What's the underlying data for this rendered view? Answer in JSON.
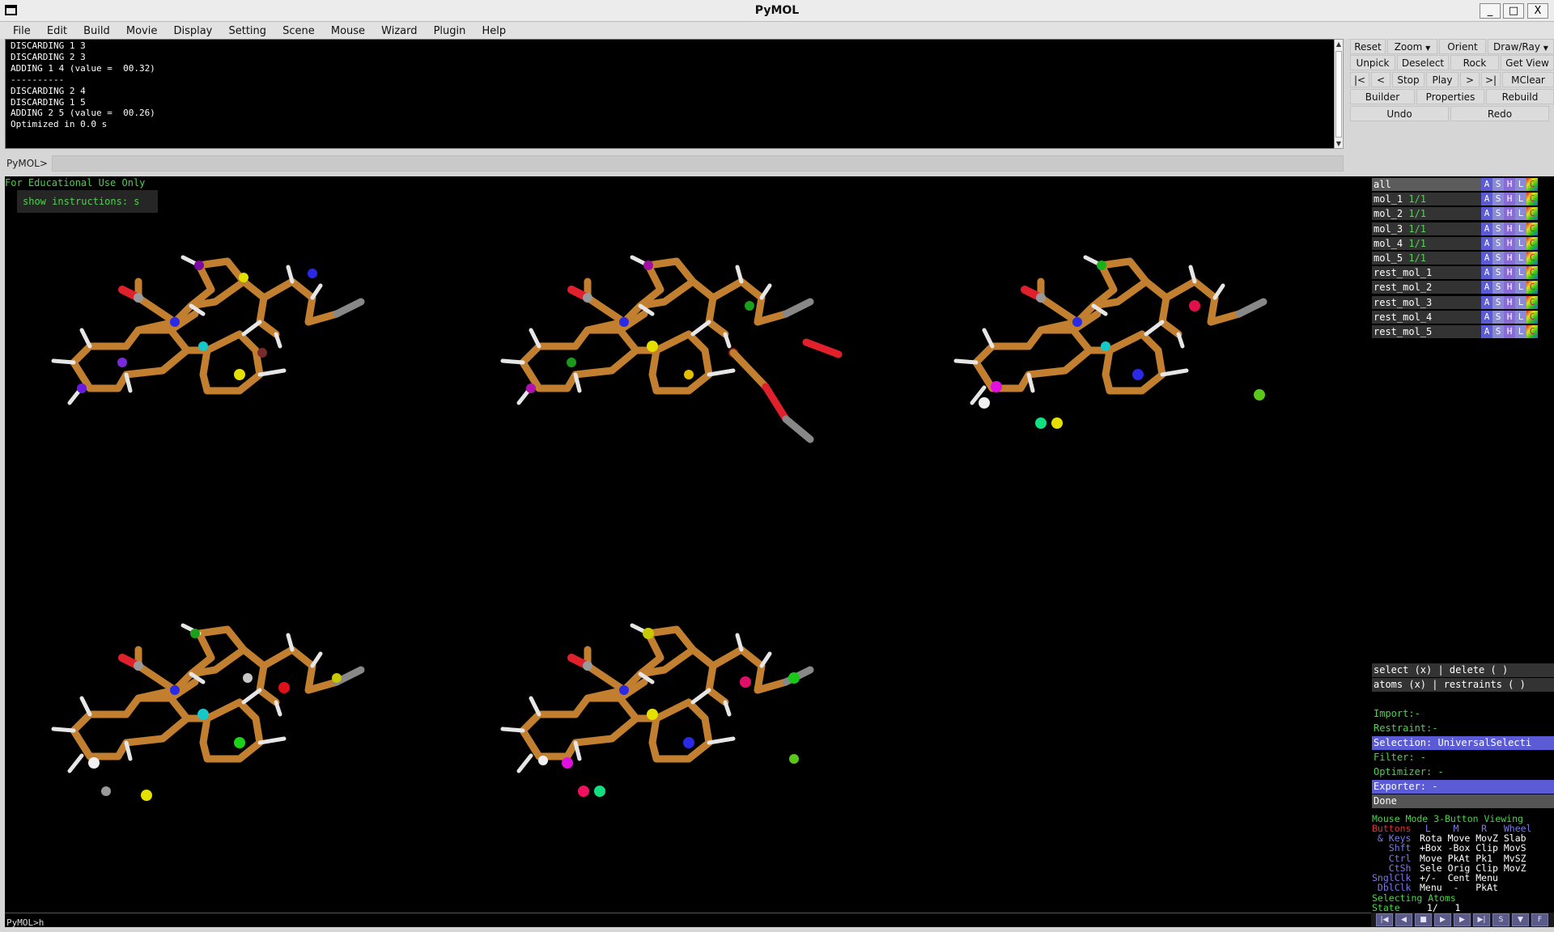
{
  "window": {
    "title": "PyMOL",
    "minimize": "_",
    "maximize": "□",
    "close": "X"
  },
  "menu": [
    "File",
    "Edit",
    "Build",
    "Movie",
    "Display",
    "Setting",
    "Scene",
    "Mouse",
    "Wizard",
    "Plugin",
    "Help"
  ],
  "console": {
    "lines": [
      "DISCARDING 1 3",
      "DISCARDING 2 3",
      "ADDING 1 4 (value =  00.32)",
      "----------",
      "DISCARDING 2 4",
      "DISCARDING 1 5",
      "ADDING 2 5 (value =  00.26)",
      "Optimized in 0.0 s"
    ]
  },
  "command": {
    "prompt": "PyMOL>",
    "bottom_prompt": "PyMOL>h_"
  },
  "buttons": {
    "row1": [
      "Reset",
      "Zoom",
      "Orient",
      "Draw/Ray"
    ],
    "row2": [
      "Unpick",
      "Deselect",
      "Rock",
      "Get View"
    ],
    "row3": [
      "|<",
      "<",
      "Stop",
      "Play",
      ">",
      ">|",
      "MClear"
    ],
    "row4": [
      "Builder",
      "Properties",
      "Rebuild"
    ],
    "row5": [
      "Undo",
      "Redo"
    ]
  },
  "viewer": {
    "edu_text": "For Educational Use Only",
    "instructions": "show instructions: s"
  },
  "objects": [
    {
      "name": "all",
      "state": ""
    },
    {
      "name": "mol_1",
      "state": "1/1"
    },
    {
      "name": "mol_2",
      "state": "1/1"
    },
    {
      "name": "mol_3",
      "state": "1/1"
    },
    {
      "name": "mol_4",
      "state": "1/1"
    },
    {
      "name": "mol_5",
      "state": "1/1"
    },
    {
      "name": "rest_mol_1",
      "state": ""
    },
    {
      "name": "rest_mol_2",
      "state": ""
    },
    {
      "name": "rest_mol_3",
      "state": ""
    },
    {
      "name": "rest_mol_4",
      "state": ""
    },
    {
      "name": "rest_mol_5",
      "state": ""
    }
  ],
  "obj_buttons": [
    "A",
    "S",
    "H",
    "L",
    "C"
  ],
  "wizard": {
    "select_line": "select (x) | delete  ( )",
    "atoms_line": "atoms  (x) | restraints ( )",
    "import": "Import:-",
    "restraint": "Restraint:-",
    "selection": "Selection: UniversalSelecti",
    "filter": "Filter: -",
    "optimizer": "Optimizer: -",
    "exporter": "Exporter: -",
    "done": "Done"
  },
  "mouse_mode": {
    "title": "Mouse Mode 3-Button Viewing",
    "rows": [
      {
        "k": "Buttons",
        "v": " L    M    R   Wheel"
      },
      {
        "k": " & Keys",
        "v": "Rota Move MovZ Slab"
      },
      {
        "k": "   Shft",
        "v": "+Box -Box Clip MovS"
      },
      {
        "k": "   Ctrl",
        "v": "Move PkAt Pk1  MvSZ"
      },
      {
        "k": "   CtSh",
        "v": "Sele Orig Clip MovZ"
      },
      {
        "k": "SnglClk",
        "v": "+/-  Cent Menu"
      },
      {
        "k": " DblClk",
        "v": "Menu  -   PkAt"
      }
    ],
    "selecting": "Selecting Atoms",
    "state_label": "State",
    "state_value": "  1/   1"
  },
  "transport": [
    "|◀",
    "◀",
    "■",
    "▶",
    "▶",
    "▶|",
    "S",
    "▼",
    "F"
  ],
  "colors": {
    "bond": "#c27f30",
    "nitrogen": "#2a2ae6",
    "oxygen": "#e0202a",
    "hydrogen": "#e6e6e6",
    "carbon": "#8a8a8a"
  }
}
